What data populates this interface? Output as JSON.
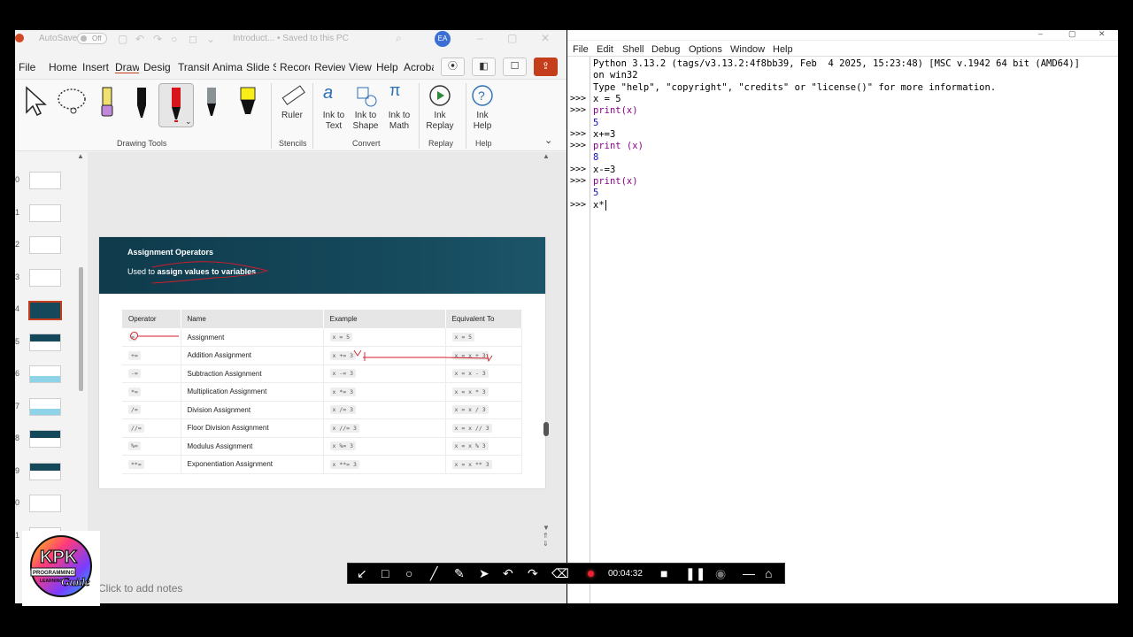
{
  "ppt": {
    "titlebar": {
      "autosave": "AutoSave",
      "autosave_state": "Off",
      "doc_title": "Introduct... • Saved to this PC",
      "avatar": "EA"
    },
    "tabs": [
      "File",
      "Home",
      "Insert",
      "Draw",
      "Desig",
      "Transit",
      "Anima",
      "Slide S",
      "Recorc",
      "Review",
      "View",
      "Help",
      "Acroba"
    ],
    "active_tab": "Draw",
    "ribbon": {
      "groups": {
        "drawing_tools": "Drawing Tools",
        "stencils": "Stencils",
        "convert": "Convert",
        "replay": "Replay",
        "help": "Help"
      },
      "buttons": {
        "ruler": "Ruler",
        "ink_to_text": "Ink to\nText",
        "ink_to_shape": "Ink to\nShape",
        "ink_to_math": "Ink to\nMath",
        "ink_replay": "Ink\nReplay",
        "ink_help": "Ink\nHelp"
      }
    },
    "thumbnails": [
      {
        "num": "0"
      },
      {
        "num": "1"
      },
      {
        "num": "2"
      },
      {
        "num": "3"
      },
      {
        "num": "4"
      },
      {
        "num": "5"
      },
      {
        "num": "6"
      },
      {
        "num": "7"
      },
      {
        "num": "8"
      },
      {
        "num": "9"
      },
      {
        "num": "0"
      },
      {
        "num": "1"
      }
    ],
    "slide": {
      "title": "Assignment Operators",
      "subtitle_prefix": "Used to ",
      "subtitle_bold": "assign values to variables",
      "table": {
        "headers": [
          "Operator",
          "Name",
          "Example",
          "Equivalent To"
        ],
        "rows": [
          [
            "=",
            "Assignment",
            "x = 5",
            "x = 5"
          ],
          [
            "+=",
            "Addition Assignment",
            "x += 3",
            "x = x + 3"
          ],
          [
            "-=",
            "Subtraction Assignment",
            "x -= 3",
            "x = x - 3"
          ],
          [
            "*=",
            "Multiplication Assignment",
            "x *= 3",
            "x = x * 3"
          ],
          [
            "/=",
            "Division Assignment",
            "x /= 3",
            "x = x / 3"
          ],
          [
            "//=",
            "Floor Division Assignment",
            "x //= 3",
            "x = x // 3"
          ],
          [
            "%=",
            "Modulus Assignment",
            "x %= 3",
            "x = x % 3"
          ],
          [
            "**=",
            "Exponentiation Assignment",
            "x **= 3",
            "x = x ** 3"
          ]
        ]
      }
    },
    "notes_placeholder": "Click to add notes"
  },
  "idle": {
    "menu": [
      "File",
      "Edit",
      "Shell",
      "Debug",
      "Options",
      "Window",
      "Help"
    ],
    "lines": [
      {
        "prompt": "",
        "text": "Python 3.13.2 (tags/v3.13.2:4f8bb39, Feb  4 2025, 15:23:48) [MSC v.1942 64 bit (AMD64)]",
        "cls": ""
      },
      {
        "prompt": "",
        "text": "on win32",
        "cls": ""
      },
      {
        "prompt": "",
        "text": "Type \"help\", \"copyright\", \"credits\" or \"license()\" for more information.",
        "cls": ""
      },
      {
        "prompt": ">>>",
        "text": "x = 5",
        "cls": ""
      },
      {
        "prompt": ">>>",
        "text": "print(x)",
        "cls": "kw"
      },
      {
        "prompt": "",
        "text": "5",
        "cls": "out"
      },
      {
        "prompt": ">>>",
        "text": "x+=3",
        "cls": ""
      },
      {
        "prompt": ">>>",
        "text": "print (x)",
        "cls": "kw"
      },
      {
        "prompt": "",
        "text": "8",
        "cls": "out"
      },
      {
        "prompt": ">>>",
        "text": "x-=3",
        "cls": ""
      },
      {
        "prompt": ">>>",
        "text": "print(x)",
        "cls": "kw"
      },
      {
        "prompt": "",
        "text": "5",
        "cls": "out"
      },
      {
        "prompt": ">>>",
        "text": "x*",
        "cls": ""
      }
    ]
  },
  "recorder": {
    "elapsed": "00:04:32"
  },
  "logo": {
    "text_big": "KPK",
    "text_small": "PROGRAMMING",
    "text_small2": "LEARNING",
    "text_script": "Guide"
  }
}
